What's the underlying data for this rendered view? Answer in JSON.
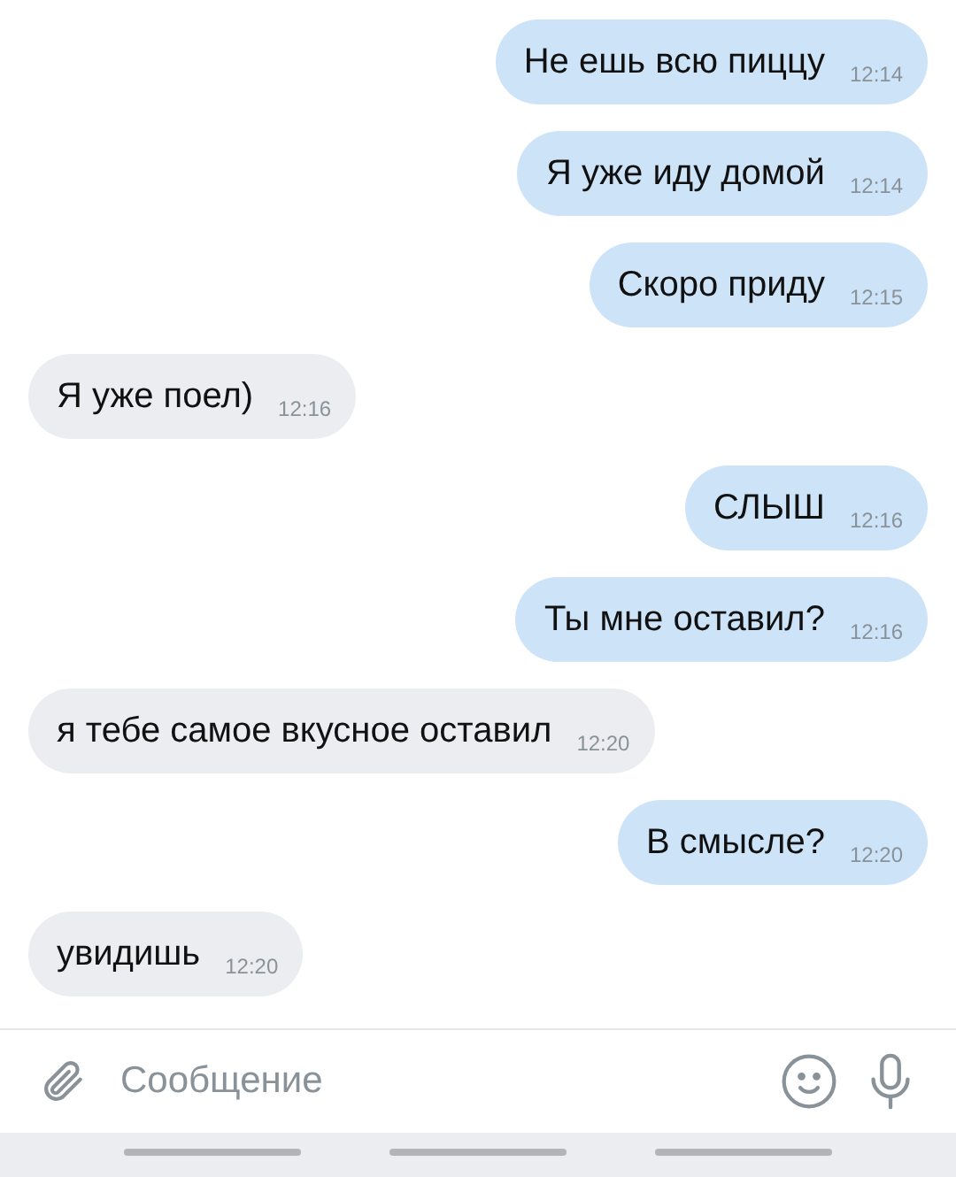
{
  "messages": [
    {
      "kind": "outgoing",
      "text": "Не ешь всю пиццу",
      "time": "12:14"
    },
    {
      "kind": "outgoing",
      "text": "Я уже иду домой",
      "time": "12:14"
    },
    {
      "kind": "outgoing",
      "text": "Скоро приду",
      "time": "12:15"
    },
    {
      "kind": "incoming",
      "text": "Я уже поел)",
      "time": "12:16"
    },
    {
      "kind": "outgoing",
      "text": "СЛЫШ",
      "time": "12:16"
    },
    {
      "kind": "outgoing",
      "text": "Ты мне оставил?",
      "time": "12:16"
    },
    {
      "kind": "incoming",
      "text": "я тебе самое вкусное оставил",
      "time": "12:20"
    },
    {
      "kind": "outgoing",
      "text": "В смысле?",
      "time": "12:20"
    },
    {
      "kind": "incoming",
      "text": "увидишь",
      "time": "12:20"
    }
  ],
  "composer": {
    "placeholder": "Сообщение"
  }
}
